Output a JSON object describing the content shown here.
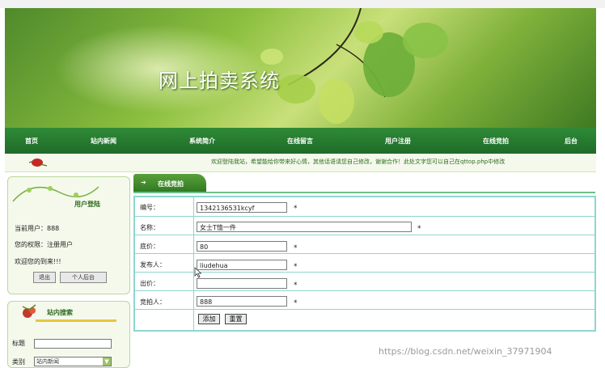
{
  "banner": {
    "title": "网上拍卖系统"
  },
  "nav": {
    "items": [
      "首页",
      "站内新闻",
      "系统简介",
      "在线留言",
      "用户注册",
      "在线竞拍",
      "后台"
    ]
  },
  "ticker": {
    "text": "欢迎登陆我站，希望能给你带来好心情，其他话语请您自己修改，谢谢合作！此处文字您可以自己在qttop.php中修改"
  },
  "login_panel": {
    "title": "用户登陆",
    "current_user_label": "当前用户：888",
    "role_label": "您的权限：注册用户",
    "welcome": "欢迎您的到来!!!",
    "logout_button": "退出",
    "backend_button": "个人后台"
  },
  "search_panel": {
    "title": "站内搜索",
    "title_label": "标题",
    "category_label": "类别",
    "category_value": "站内新闻"
  },
  "form": {
    "tab_label": "在线竞拍",
    "tab_arrow": "➔",
    "fields": [
      {
        "label": "编号：",
        "value": "1342136531kcyf",
        "required": "*"
      },
      {
        "label": "名称：",
        "value": "女士T恤一件",
        "required": "*"
      },
      {
        "label": "底价：",
        "value": "80",
        "required": "*"
      },
      {
        "label": "发布人：",
        "value": "liudehua",
        "required": "*"
      },
      {
        "label": "出价：",
        "value": "",
        "required": "*"
      },
      {
        "label": "竞拍人：",
        "value": "888",
        "required": "*"
      }
    ],
    "add_button": "添加",
    "reset_button": "重置"
  },
  "watermark": "https://blog.csdn.net/weixin_37971904",
  "colors": {
    "nav_green": "#1f6b2a",
    "panel_bg": "#f4f9ec",
    "form_border": "#8ed6cf",
    "accent_text": "#2f6b1f"
  }
}
